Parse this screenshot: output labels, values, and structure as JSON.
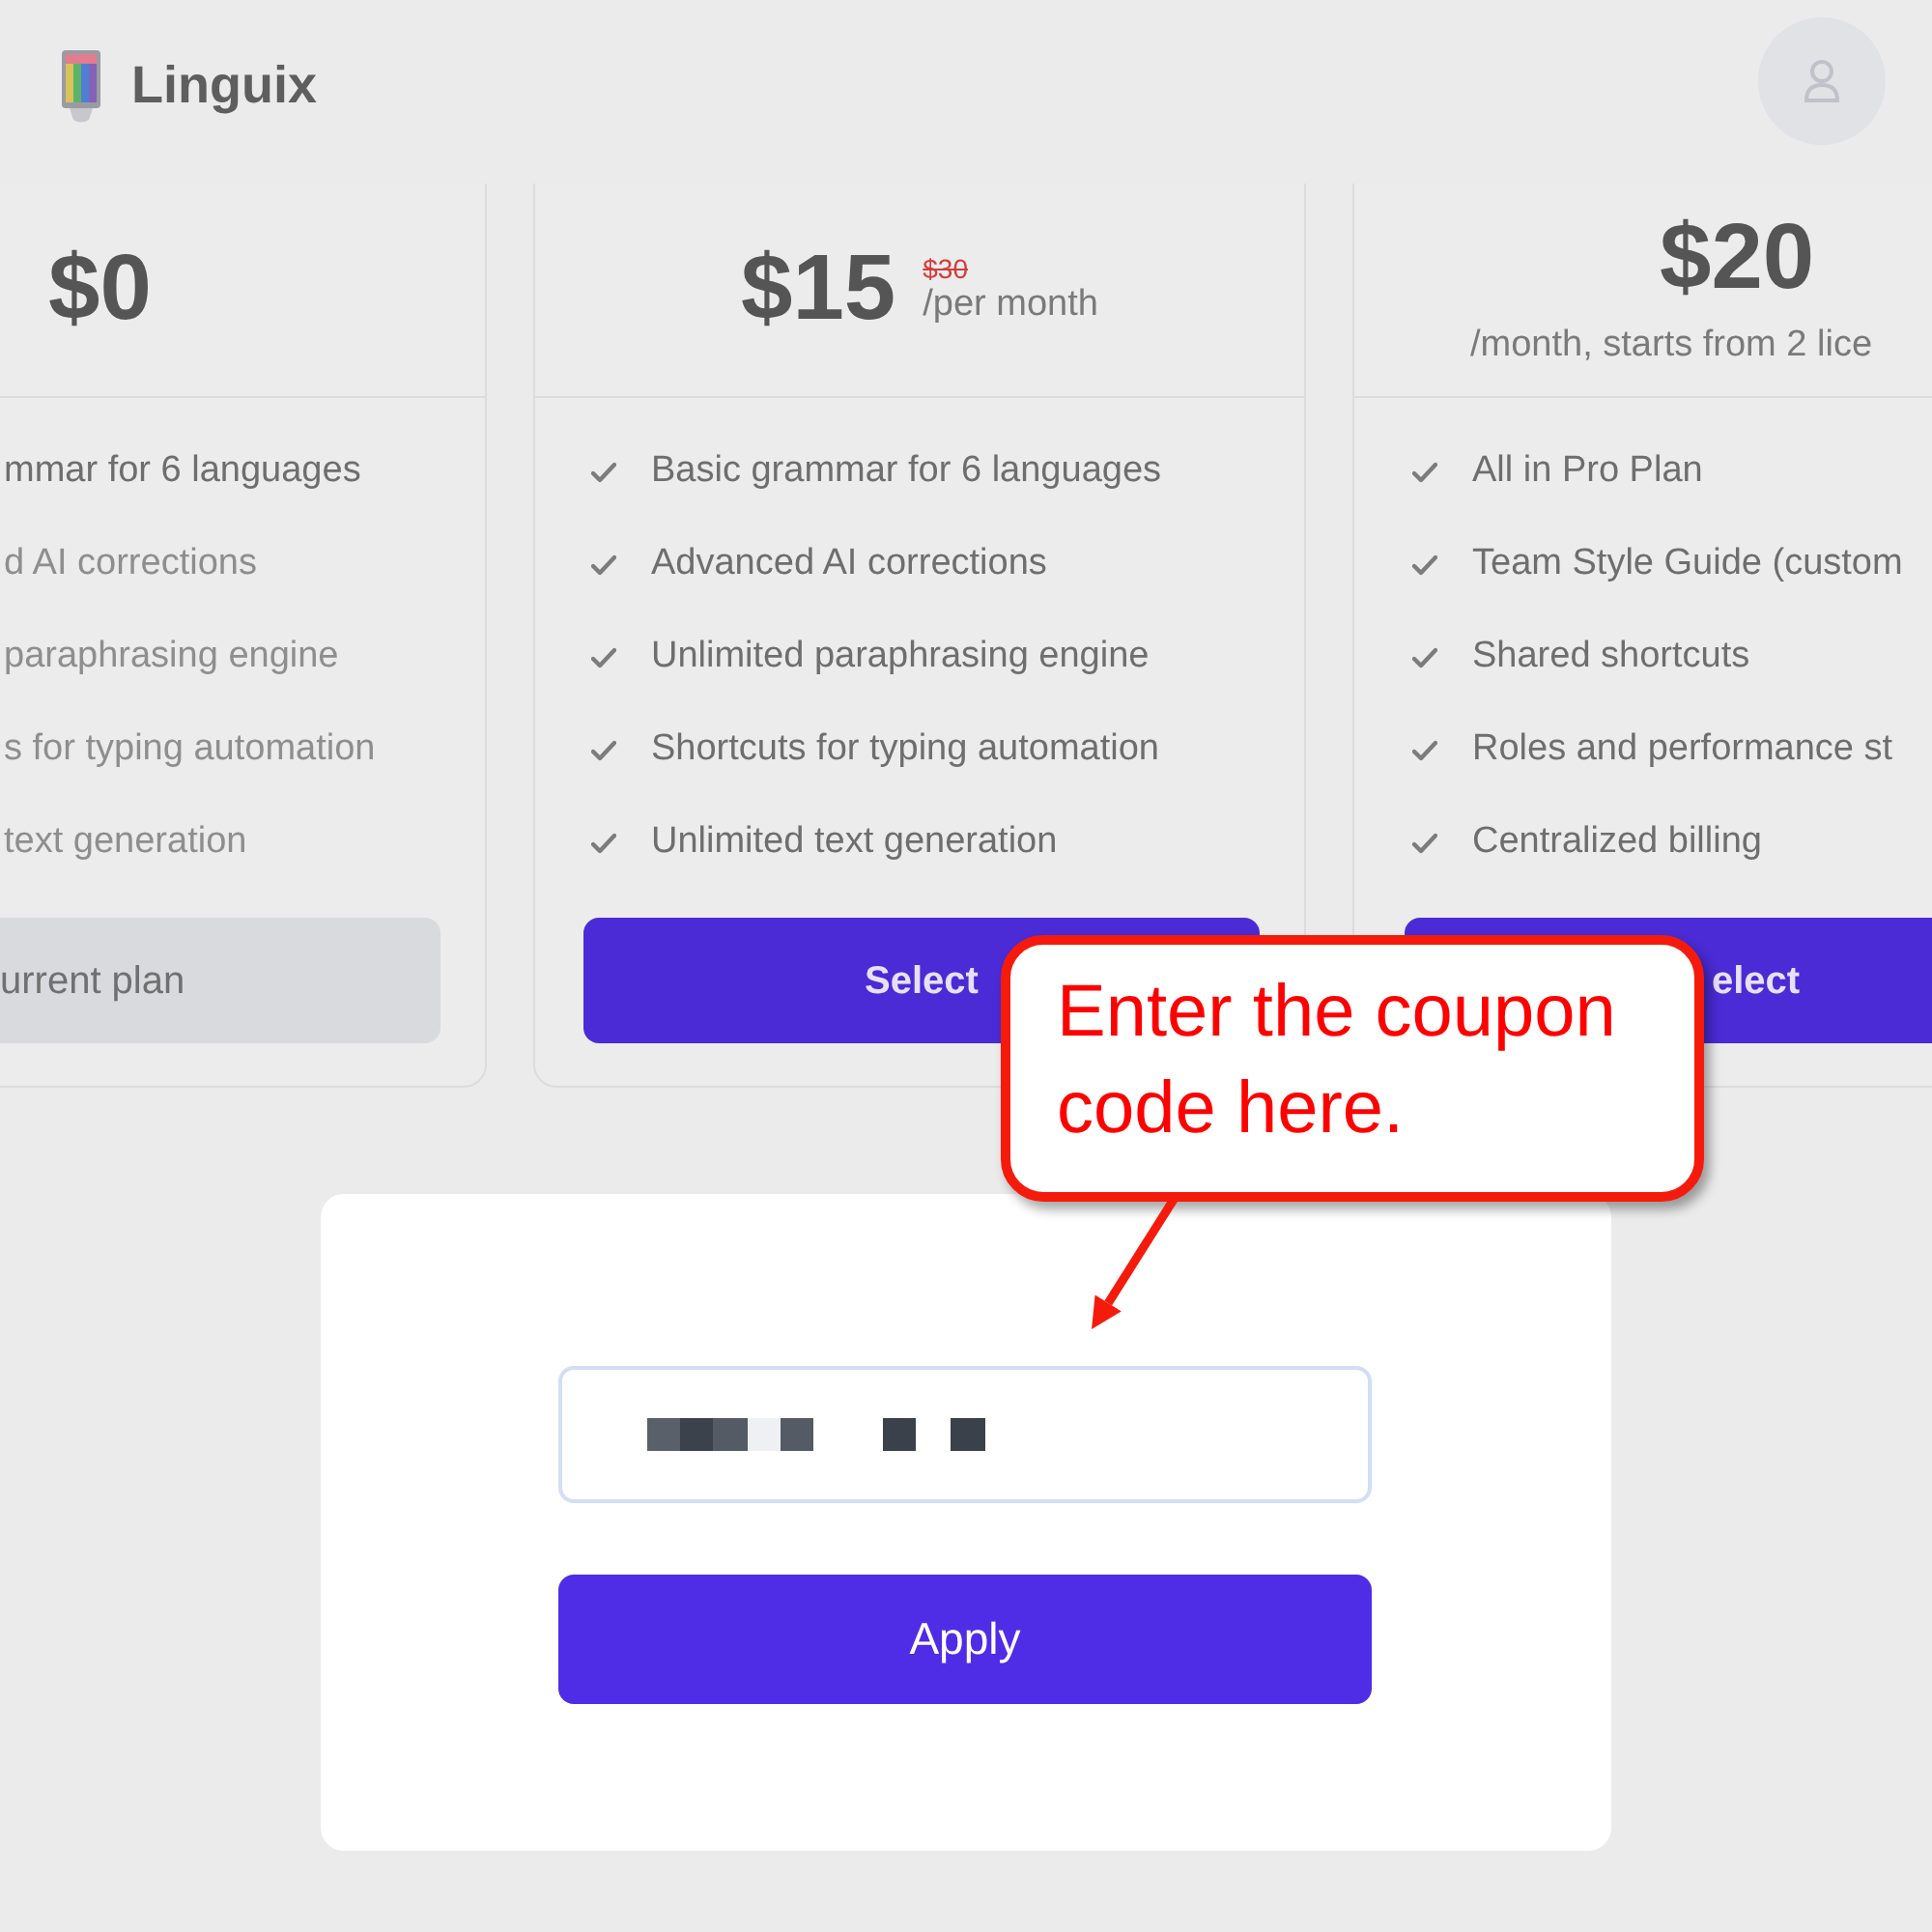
{
  "header": {
    "logo_text": "Linguix"
  },
  "plans": [
    {
      "price": "$0",
      "check_icons": false,
      "features": [
        {
          "text": "mmar for 6 languages",
          "included": true
        },
        {
          "text": "d AI corrections",
          "included": false
        },
        {
          "text": "paraphrasing engine",
          "included": false
        },
        {
          "text": "s for typing automation",
          "included": false
        },
        {
          "text": "text generation",
          "included": false
        }
      ],
      "button": {
        "label": "urrent plan",
        "kind": "current"
      }
    },
    {
      "price": "$15",
      "old_price": "$30",
      "period": "/per month",
      "check_icons": true,
      "features": [
        {
          "text": "Basic grammar for 6 languages",
          "included": true
        },
        {
          "text": "Advanced AI corrections",
          "included": true
        },
        {
          "text": "Unlimited paraphrasing engine",
          "included": true
        },
        {
          "text": "Shortcuts for typing automation",
          "included": true
        },
        {
          "text": "Unlimited text generation",
          "included": true
        }
      ],
      "button": {
        "label": "Select",
        "kind": "primary"
      }
    },
    {
      "price": "$20",
      "subtitle": "/month, starts from 2 lice",
      "check_icons": true,
      "features": [
        {
          "text": "All in Pro Plan",
          "included": true
        },
        {
          "text": "Team Style Guide (custom",
          "included": true
        },
        {
          "text": "Shared shortcuts",
          "included": true
        },
        {
          "text": "Roles and performance st",
          "included": true
        },
        {
          "text": "Centralized billing",
          "included": true
        }
      ],
      "button": {
        "label": "elect",
        "kind": "primary"
      }
    }
  ],
  "coupon_modal": {
    "field": {
      "redacted": true
    },
    "apply_button": "Apply"
  },
  "callout": {
    "text": "Enter the coupon code here."
  }
}
